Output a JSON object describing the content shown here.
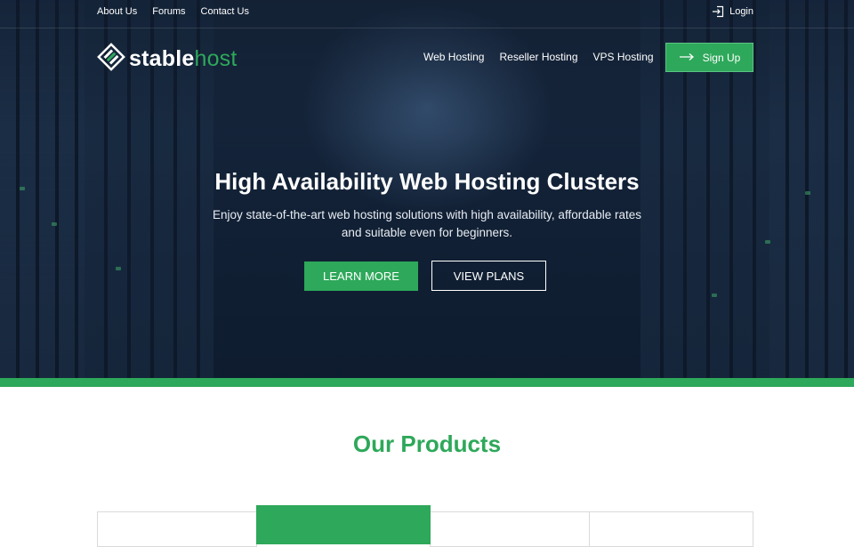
{
  "topbar": {
    "links": [
      "About Us",
      "Forums",
      "Contact Us"
    ],
    "login_label": "Login"
  },
  "brand": {
    "name_part1": "stable",
    "name_part2": "host"
  },
  "nav": {
    "items": [
      "Web Hosting",
      "Reseller Hosting",
      "VPS Hosting"
    ],
    "signup_label": "Sign Up"
  },
  "hero": {
    "title": "High Availability Web Hosting Clusters",
    "subtitle": "Enjoy state-of-the-art web hosting solutions with high availability, affordable rates and suitable even for beginners.",
    "primary_button": "LEARN MORE",
    "secondary_button": "VIEW PLANS"
  },
  "products": {
    "title": "Our Products",
    "cards_count": 4,
    "highlighted_card": 2
  },
  "colors": {
    "accent": "#2ea85a",
    "hero_bg": "#14243a",
    "text_light": "#ffffff"
  },
  "icons": {
    "login": "login-icon",
    "signup": "arrow-right-icon",
    "logo": "logo-mark-icon"
  }
}
